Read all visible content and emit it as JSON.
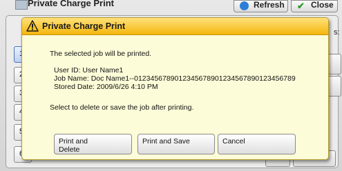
{
  "background": {
    "title": "Private Charge Print",
    "refresh_label": "Refresh",
    "close_label": "Close",
    "right_fragment": "s:",
    "row_numbers": [
      "1",
      "2",
      "3",
      "4",
      "5",
      "6"
    ]
  },
  "dialog": {
    "title": "Private Charge Print",
    "message_intro": "The selected job will be printed.",
    "user_id": "User ID: User Name1",
    "job_name": "Job Name: Doc Name1--0123456789012345678901234567890123456789",
    "stored_date": "Stored Date: 2009/6/26 4:10 PM",
    "message_action": "Select to delete or save the job after printing.",
    "buttons": {
      "print_delete_line1": "Print and",
      "print_delete_line2": "Delete",
      "print_save": "Print and Save",
      "cancel": "Cancel"
    }
  },
  "colors": {
    "header_top": "#ffe17a",
    "header_bottom": "#f4b60e",
    "dialog_bg": "#fdfcd8"
  },
  "icons": {
    "warning": "warning-triangle-icon",
    "refresh": "refresh-icon",
    "close": "checkmark-close-icon",
    "document": "document-icon"
  }
}
